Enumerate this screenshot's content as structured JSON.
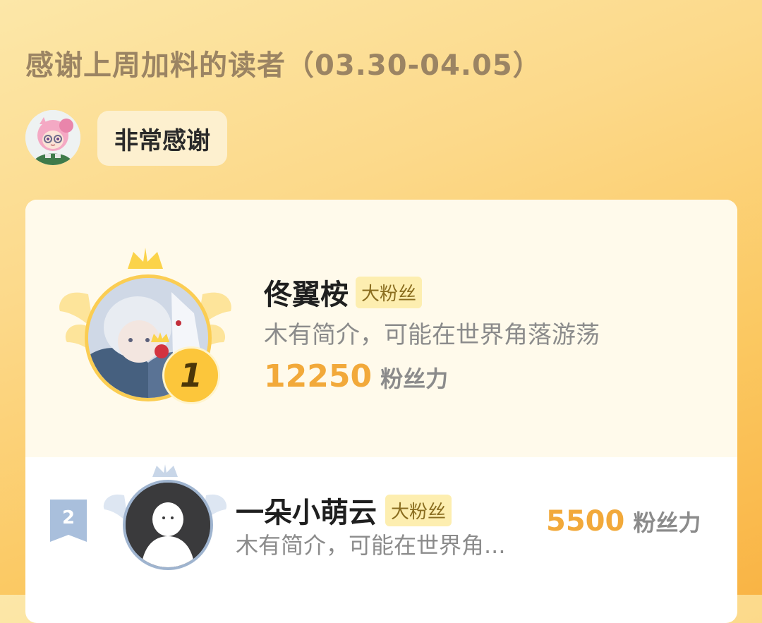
{
  "header": {
    "title": "感谢上周加料的读者（03.30-04.05）"
  },
  "editor_message": {
    "avatar_icon": "editor-avatar-icon",
    "text": "非常感谢"
  },
  "ranking": [
    {
      "rank": "1",
      "name": "佟翼桉",
      "tag": "大粉丝",
      "intro": "木有简介，可能在世界角落游荡",
      "score": "12250",
      "score_unit": "粉丝力"
    },
    {
      "rank": "2",
      "name": "一朵小萌云",
      "tag": "大粉丝",
      "intro": "木有简介，可能在世界角...",
      "score": "5500",
      "score_unit": "粉丝力"
    }
  ],
  "colors": {
    "background_top": "#fce7a8",
    "background_bottom": "#f9b445",
    "gold": "#fcc63b",
    "score": "#f2a93a",
    "silver": "#9fb4cf"
  }
}
